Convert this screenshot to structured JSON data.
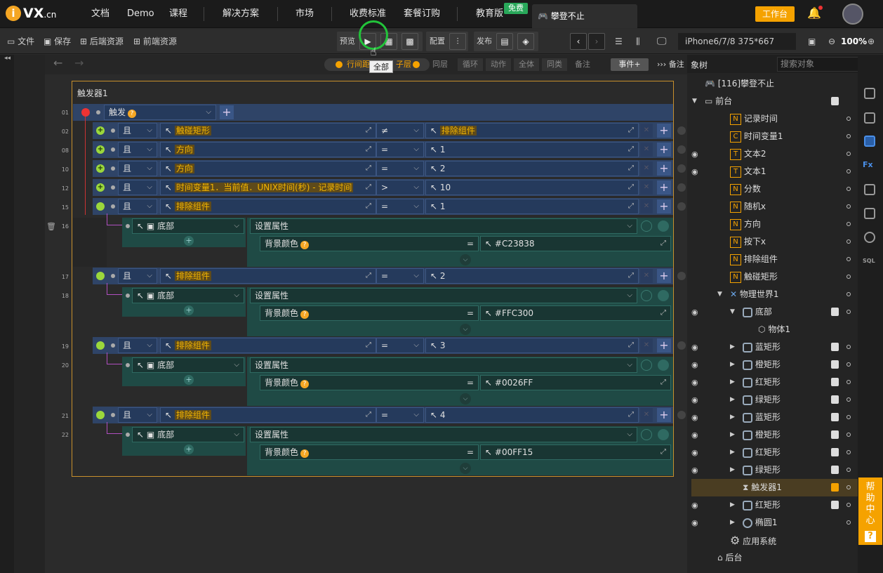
{
  "topnav": {
    "logo_text": "VX",
    "logo_domain": ".cn",
    "items": [
      "文档",
      "Demo",
      "课程",
      "解决方案",
      "市场",
      "收费标准",
      "套餐订购",
      "教育版"
    ],
    "free_badge": "免费",
    "project_tab": "攀登不止",
    "work_button": "工作台"
  },
  "toolbar": {
    "file": "文件",
    "save": "保存",
    "backend": "后端资源",
    "frontend": "前端资源",
    "preview": "预览",
    "config": "配置",
    "publish": "发布",
    "device": "iPhone6/7/8 375*667",
    "zoom": "100%",
    "tooltip": "全部"
  },
  "bar2": {
    "row_gap": "行间距",
    "child_layer": "子层",
    "same_layer": "同层",
    "loop": "循环",
    "action": "动作",
    "all": "全体",
    "same_kind": "同类",
    "note": "备注",
    "event_btn": "事件+",
    "note2": "备注"
  },
  "trigger": {
    "title": "触发器1",
    "event_label": "触发",
    "rows": [
      {
        "num": "01"
      },
      {
        "num": "02",
        "op_label": "且",
        "left": "触碰矩形",
        "cmp": "≠",
        "right": "排除组件",
        "right_hl": true
      },
      {
        "num": "08",
        "op_label": "且",
        "left": "方向",
        "cmp": "=",
        "right": "1",
        "right_hl": false
      },
      {
        "num": "10",
        "op_label": "且",
        "left": "方向",
        "cmp": "=",
        "right": "2",
        "right_hl": false
      },
      {
        "num": "12",
        "op_label": "且",
        "left": "时间变量1．当前值．UNIX时间(秒) - 记录时间",
        "cmp": ">",
        "right": "10",
        "right_hl": false
      },
      {
        "num": "15",
        "op_label": "且",
        "left": "排除组件",
        "cmp": "=",
        "right": "1",
        "right_hl": false
      },
      {
        "num": "16"
      },
      {
        "num": "17",
        "op_label": "且",
        "left": "排除组件",
        "cmp": "=",
        "right": "2",
        "right_hl": false
      },
      {
        "num": "18"
      },
      {
        "num": "19",
        "op_label": "且",
        "left": "排除组件",
        "cmp": "=",
        "right": "3",
        "right_hl": false
      },
      {
        "num": "20"
      },
      {
        "num": "21",
        "op_label": "且",
        "left": "排除组件",
        "cmp": "=",
        "right": "4",
        "right_hl": false
      },
      {
        "num": "22"
      }
    ],
    "actions": [
      {
        "target": "底部",
        "action": "设置属性",
        "prop": "背景颜色",
        "value": "#C23838"
      },
      {
        "target": "底部",
        "action": "设置属性",
        "prop": "背景颜色",
        "value": "#FFC300"
      },
      {
        "target": "底部",
        "action": "设置属性",
        "prop": "背景颜色",
        "value": "#0026FF"
      },
      {
        "target": "底部",
        "action": "设置属性",
        "prop": "背景颜色",
        "value": "#00FF15"
      }
    ]
  },
  "tree": {
    "header": "象树",
    "search_placeholder": "搜索对象",
    "items": [
      {
        "label": "[116]攀登不止",
        "icon": "gamepad-icon"
      },
      {
        "label": "前台",
        "icon": "stage-icon"
      },
      {
        "label": "记录时间",
        "icon": "number-var-icon",
        "glyph": "N"
      },
      {
        "label": "时间变量1",
        "icon": "time-var-icon",
        "glyph": "C"
      },
      {
        "label": "文本2",
        "icon": "text-icon",
        "glyph": "T"
      },
      {
        "label": "文本1",
        "icon": "text-icon",
        "glyph": "T"
      },
      {
        "label": "分数",
        "icon": "number-var-icon",
        "glyph": "N"
      },
      {
        "label": "随机x",
        "icon": "number-var-icon",
        "glyph": "N"
      },
      {
        "label": "方向",
        "icon": "number-var-icon",
        "glyph": "N"
      },
      {
        "label": "按下x",
        "icon": "number-var-icon",
        "glyph": "N"
      },
      {
        "label": "排除组件",
        "icon": "number-var-icon",
        "glyph": "N"
      },
      {
        "label": "触碰矩形",
        "icon": "number-var-icon",
        "glyph": "N"
      },
      {
        "label": "物理世界1",
        "icon": "physics-icon"
      },
      {
        "label": "底部",
        "icon": "body-icon"
      },
      {
        "label": "物体1",
        "icon": "cube-icon"
      },
      {
        "label": "蓝矩形",
        "icon": "body-icon"
      },
      {
        "label": "橙矩形",
        "icon": "body-icon"
      },
      {
        "label": "红矩形",
        "icon": "body-icon"
      },
      {
        "label": "绿矩形",
        "icon": "body-icon"
      },
      {
        "label": "蓝矩形",
        "icon": "body-icon"
      },
      {
        "label": "橙矩形",
        "icon": "body-icon"
      },
      {
        "label": "红矩形",
        "icon": "body-icon"
      },
      {
        "label": "绿矩形",
        "icon": "body-icon"
      },
      {
        "label": "触发器1",
        "icon": "hourglass-icon"
      },
      {
        "label": "红矩形",
        "icon": "body-icon"
      },
      {
        "label": "椭圆1",
        "icon": "ellipse-icon"
      },
      {
        "label": "应用系统",
        "icon": "gear-icon"
      },
      {
        "label": "后台",
        "icon": "backstage-icon"
      }
    ]
  },
  "help_center": "帮助中心",
  "help_q": "?"
}
